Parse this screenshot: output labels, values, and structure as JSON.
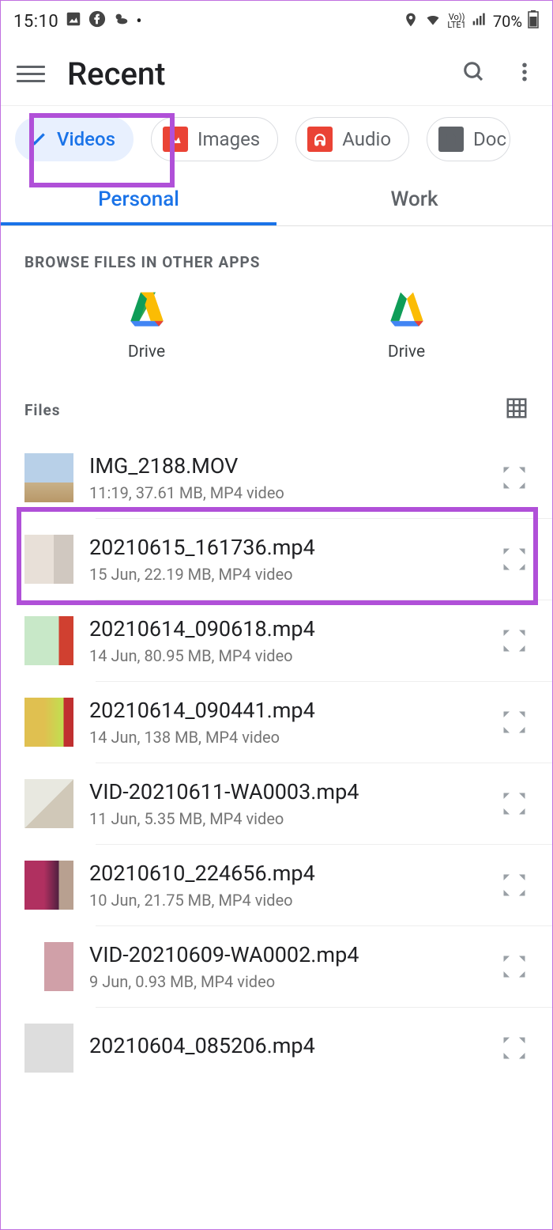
{
  "statusbar": {
    "time": "15:10",
    "battery": "70%",
    "network": "LTE1",
    "volte": "Vo))"
  },
  "header": {
    "title": "Recent"
  },
  "chips": [
    {
      "label": "Videos",
      "selected": true
    },
    {
      "label": "Images",
      "selected": false
    },
    {
      "label": "Audio",
      "selected": false
    },
    {
      "label": "Doc",
      "selected": false
    }
  ],
  "tabs": [
    {
      "label": "Personal",
      "active": true
    },
    {
      "label": "Work",
      "active": false
    }
  ],
  "browse_section": {
    "title": "Browse files in other apps",
    "apps": [
      {
        "label": "Drive"
      },
      {
        "label": "Drive"
      }
    ]
  },
  "files_section": {
    "title": "Files"
  },
  "files": [
    {
      "name": "IMG_2188.MOV",
      "meta": "11:19, 37.61 MB, MP4 video",
      "thumb_class": "thumb1"
    },
    {
      "name": "20210615_161736.mp4",
      "meta": "15 Jun, 22.19 MB, MP4 video",
      "thumb_class": "thumb2"
    },
    {
      "name": "20210614_090618.mp4",
      "meta": "14 Jun, 80.95 MB, MP4 video",
      "thumb_class": "thumb3"
    },
    {
      "name": "20210614_090441.mp4",
      "meta": "14 Jun, 138 MB, MP4 video",
      "thumb_class": "thumb4"
    },
    {
      "name": "VID-20210611-WA0003.mp4",
      "meta": "11 Jun, 5.35 MB, MP4 video",
      "thumb_class": "thumb5"
    },
    {
      "name": "20210610_224656.mp4",
      "meta": "10 Jun, 21.75 MB, MP4 video",
      "thumb_class": "thumb6"
    },
    {
      "name": "VID-20210609-WA0002.mp4",
      "meta": "9 Jun, 0.93 MB, MP4 video",
      "thumb_class": "thumb7"
    },
    {
      "name": "20210604_085206.mp4",
      "meta": "",
      "thumb_class": ""
    }
  ]
}
